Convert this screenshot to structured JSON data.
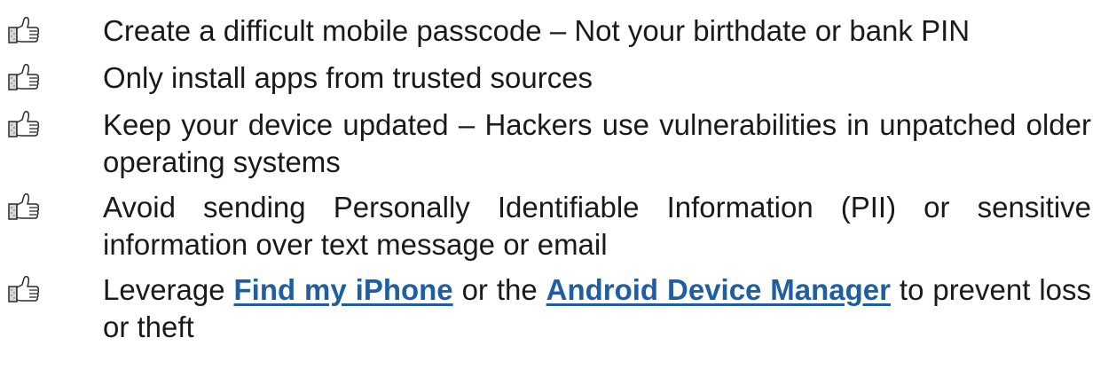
{
  "tips": [
    {
      "icon": "thumbs-up-icon",
      "text": "Create a difficult mobile passcode – Not your birthdate or bank PIN"
    },
    {
      "icon": "thumbs-up-icon",
      "text": "Only install apps from trusted sources"
    },
    {
      "icon": "thumbs-up-icon",
      "text": "Keep your device updated – Hackers use vulnerabilities in unpatched older operating systems"
    },
    {
      "icon": "thumbs-up-icon",
      "text": "Avoid sending Personally Identifiable Information (PII) or sensitive information over text message or email"
    },
    {
      "icon": "thumbs-up-icon",
      "text_before": "Leverage ",
      "link_1": "Find my iPhone",
      "text_middle": " or the ",
      "link_2": "Android Device Manager",
      "text_after": " to prevent  loss or theft"
    }
  ],
  "colors": {
    "text": "#1a1a1a",
    "link": "#1f5fa0",
    "icon_stroke": "#2b2b2b",
    "icon_cuff": "#d8d8d8"
  }
}
